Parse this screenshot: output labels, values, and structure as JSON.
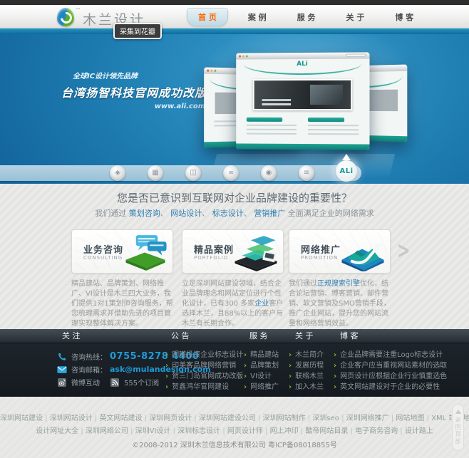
{
  "header": {
    "logo_text": "木兰设计",
    "logo_tm": "™",
    "nav": [
      {
        "label": "首 页",
        "active": true
      },
      {
        "label": "案 例"
      },
      {
        "label": "服 务"
      },
      {
        "label": "关 于"
      },
      {
        "label": "博 客"
      }
    ],
    "huaban_badge": "采集到花瓣"
  },
  "banner": {
    "tagline": "全球IC设计领先品牌",
    "title": "台湾扬智科技官网成功改版",
    "url": "www.ali.com.tw",
    "browser_logo": "ALi"
  },
  "clients": {
    "logos": [
      "◈",
      "▦",
      "◫",
      "∞",
      "◉",
      "≡"
    ],
    "active_label": "ALi"
  },
  "intro": {
    "title": "您是否已意识到互联网对企业品牌建设的重要性？",
    "lead_prefix": "我们通过 ",
    "links": [
      "策划咨询",
      "网站设计",
      "标志设计",
      "营销推广"
    ],
    "lead_suffix": " 全面满足企业的网络需求"
  },
  "services": [
    {
      "title": "业务咨询",
      "subtitle": "CONSULTING",
      "desc_pre": "精品建站、品牌策划、网络推广、VI设计是木兰四大业务，我们提供1对1策划师咨询服务，帮您梳理需求并借助先进的项目管理实现整体解决方案。",
      "desc_link": "",
      "desc_post": ""
    },
    {
      "title": "精品案例",
      "subtitle": "PORTFOLIO",
      "desc_pre": "立足深圳网站建设领域，结合企业品牌理念和网站定位进行个性化设计，已有300 多家",
      "desc_link": "企业",
      "desc_post": "客户选择木兰，且88%以上的客户与木兰有长期合作。"
    },
    {
      "title": "网络推广",
      "subtitle": "PROMOTION",
      "desc_pre": "我们通过",
      "desc_link": "正规搜索引擎",
      "desc_post": "优化，结合论坛营销、博客营销、邮件营销、软文营销及SMO营销手段，推广企业网站，提升您的网站流量和网络营销效益。"
    }
  ],
  "footer": {
    "columns": [
      {
        "title": "关 注",
        "items": []
      },
      {
        "title": "公 告",
        "items": [
          "明曦投资企业标志设计",
          "印美客品牌网络营销",
          "贺三门岛官网成功改版",
          "贺鑫鸿华官网建设"
        ]
      },
      {
        "title": "服 务",
        "items": [
          "精品建站",
          "品牌策划",
          "VI设计",
          "网络推广"
        ]
      },
      {
        "title": "关 于",
        "items": [
          "木兰简介",
          "发展历程",
          "联络木兰",
          "加入木兰"
        ]
      },
      {
        "title": "博 客",
        "items": [
          "企业品牌需要注重Logo标志设计",
          "企业客户应当重视网站素材的选取",
          "网页设计应根据企业行业慎重选色",
          "英文网站建设对于企业的必要性"
        ]
      }
    ],
    "contact": {
      "phone_label": "咨询热线：",
      "phone": "0755-8278 4400",
      "email_label": "咨询邮箱：",
      "email": "ask@mulandesign.com",
      "weibo": "微博互动",
      "rss": "555个订阅"
    }
  },
  "bottom": {
    "links_row1": [
      "深圳网站建设",
      "深圳网站设计",
      "英文网站建设",
      "深圳网页设计",
      "深圳网站建设公司",
      "深圳网站制作",
      "深圳seo",
      "深圳网络推广",
      "网站地图",
      "XML 站点地图"
    ],
    "links_row2": [
      "设计网址大全",
      "深圳网络公司",
      "深圳VI设计",
      "深圳标志设计",
      "网页设计师",
      "网上冲印",
      "酷帝网站目录",
      "电子商务咨询",
      "设计路上"
    ],
    "copyright": "©2008-2012 深圳木兰信息技术有限公司 粤ICP备08018855号",
    "back_to_top": "返回顶部"
  },
  "icons": {
    "chevron_right": ">"
  }
}
